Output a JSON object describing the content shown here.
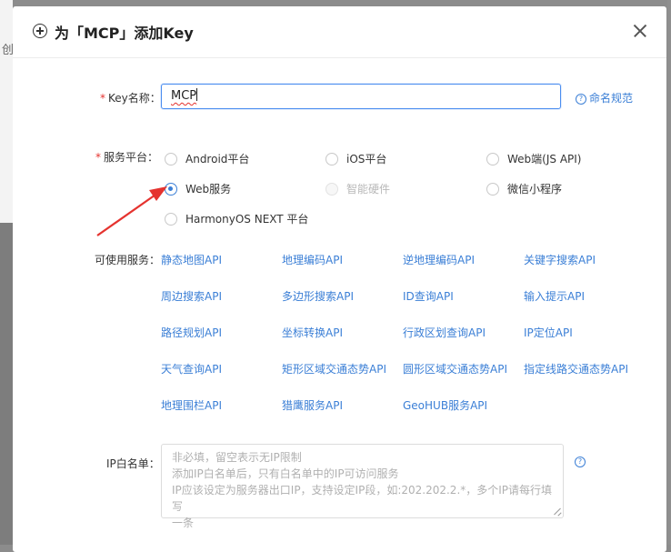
{
  "background": {
    "partial_text": "创"
  },
  "dialog": {
    "title": "为「MCP」添加Key",
    "icons": {
      "title_icon": "plus-circle-icon",
      "close": "close-icon"
    }
  },
  "form": {
    "key_name": {
      "required_mark": "*",
      "label": "Key名称：",
      "value": "MCP",
      "help_link": "命名规范"
    },
    "platform": {
      "required_mark": "*",
      "label": "服务平台：",
      "options": [
        {
          "label": "Android平台",
          "checked": false,
          "disabled": false
        },
        {
          "label": "iOS平台",
          "checked": false,
          "disabled": false
        },
        {
          "label": "Web端(JS API)",
          "checked": false,
          "disabled": false
        },
        {
          "label": "Web服务",
          "checked": true,
          "disabled": false
        },
        {
          "label": "智能硬件",
          "checked": false,
          "disabled": true
        },
        {
          "label": "微信小程序",
          "checked": false,
          "disabled": false
        },
        {
          "label": "HarmonyOS NEXT 平台",
          "checked": false,
          "disabled": false
        }
      ]
    },
    "services": {
      "label": "可使用服务：",
      "items": [
        "静态地图API",
        "地理编码API",
        "逆地理编码API",
        "关键字搜索API",
        "周边搜索API",
        "多边形搜索API",
        "ID查询API",
        "输入提示API",
        "路径规划API",
        "坐标转换API",
        "行政区划查询API",
        "IP定位API",
        "天气查询API",
        "矩形区域交通态势API",
        "圆形区域交通态势API",
        "指定线路交通态势API",
        "地理围栏API",
        "猎鹰服务API",
        "GeoHUB服务API"
      ]
    },
    "ip_whitelist": {
      "label": "IP白名单：",
      "placeholder_lines": [
        "非必填，留空表示无IP限制",
        "添加IP白名单后，只有白名单中的IP可访问服务",
        "IP应该设定为服务器出口IP，支持设定IP段，如:202.202.2.*，多个IP请每行填写",
        "一条"
      ]
    }
  },
  "colors": {
    "accent": "#3b7fd6",
    "required": "#e5332f",
    "annotation_arrow": "#e5332f"
  }
}
